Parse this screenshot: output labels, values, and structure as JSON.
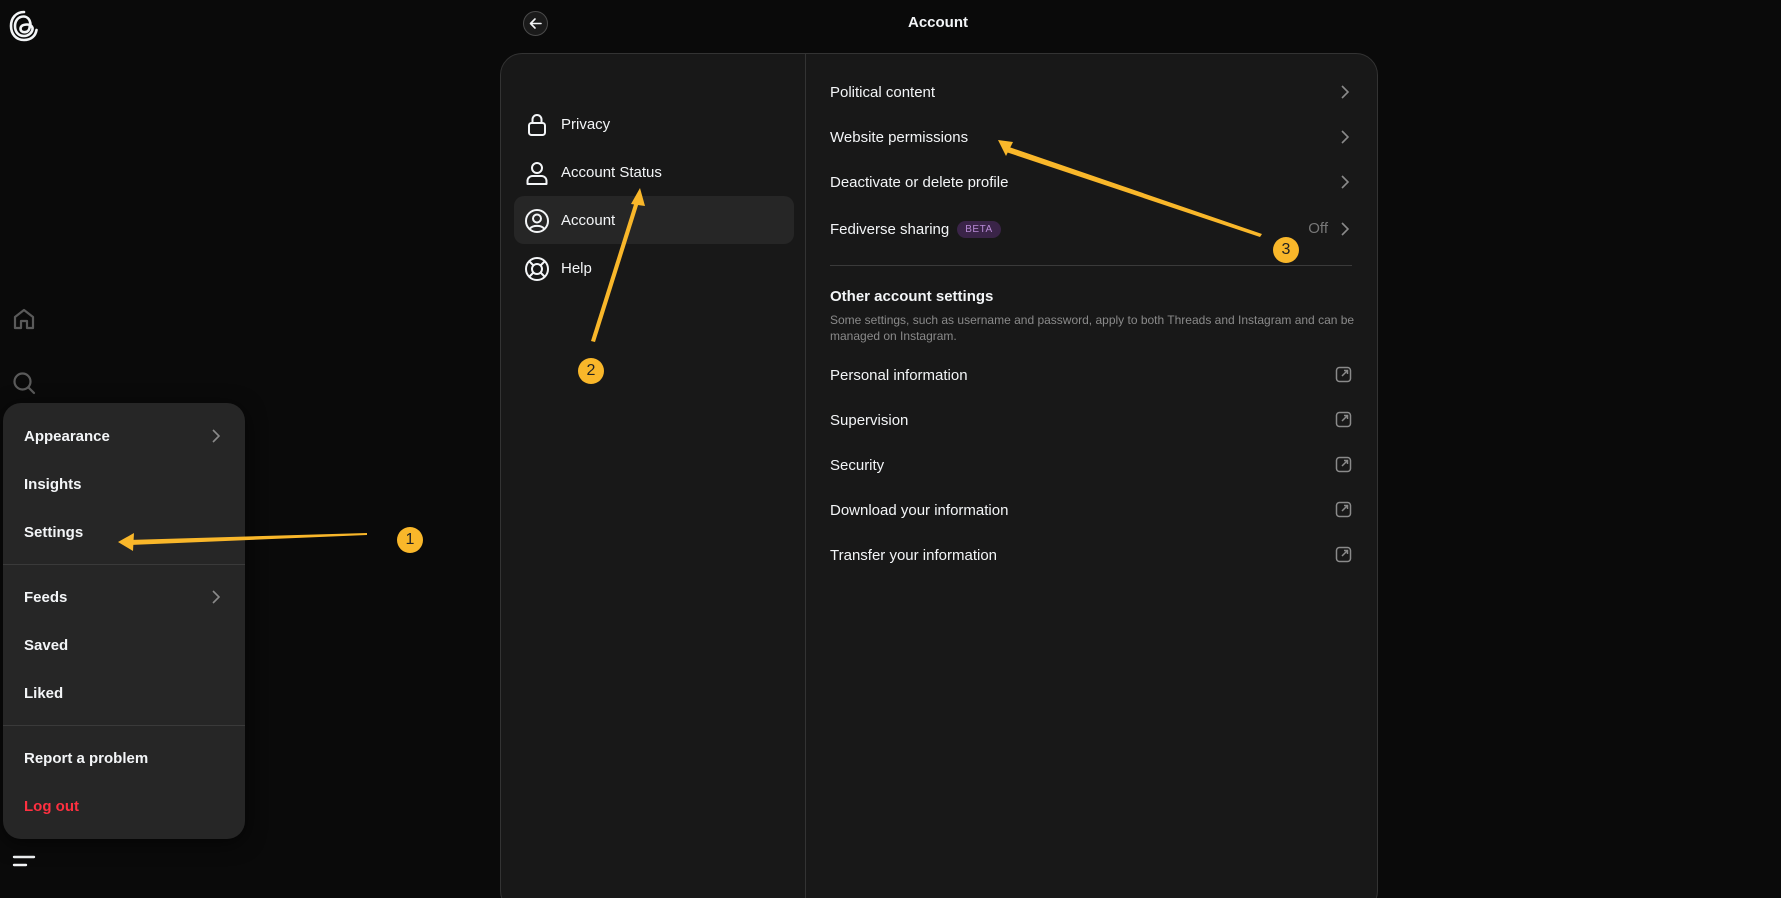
{
  "header": {
    "title": "Account"
  },
  "rail": {
    "icons": [
      "threads-logo",
      "home-icon",
      "search-icon",
      "menu-icon"
    ]
  },
  "menu": {
    "items": [
      {
        "label": "Appearance",
        "has_chevron": true
      },
      {
        "label": "Insights"
      },
      {
        "label": "Settings"
      },
      {
        "label": "Feeds",
        "has_chevron": true
      },
      {
        "label": "Saved"
      },
      {
        "label": "Liked"
      },
      {
        "label": "Report a problem"
      },
      {
        "label": "Log out",
        "danger": true
      }
    ]
  },
  "nav": {
    "items": [
      {
        "label": "Privacy",
        "icon": "lock-icon"
      },
      {
        "label": "Account Status",
        "icon": "person-icon"
      },
      {
        "label": "Account",
        "icon": "account-circle-icon",
        "active": true
      },
      {
        "label": "Help",
        "icon": "lifebuoy-icon"
      }
    ]
  },
  "content": {
    "rows": [
      {
        "label": "Political content"
      },
      {
        "label": "Website permissions"
      },
      {
        "label": "Deactivate or delete profile"
      },
      {
        "label": "Fediverse sharing",
        "badge": "BETA",
        "trailing": "Off"
      }
    ],
    "other_section": {
      "title": "Other account settings",
      "description": "Some settings, such as username and password, apply to both Threads and Instagram and can be managed on Instagram."
    },
    "external_rows": [
      {
        "label": "Personal information"
      },
      {
        "label": "Supervision"
      },
      {
        "label": "Security"
      },
      {
        "label": "Download your information"
      },
      {
        "label": "Transfer your information"
      }
    ]
  },
  "annotations": {
    "badges": [
      "1",
      "2",
      "3"
    ],
    "color": "#f9b72a"
  },
  "colors": {
    "background": "#0a0a0a",
    "card": "#181818",
    "menu": "#262626",
    "danger": "#ff3040",
    "beta_bg": "#3a2448",
    "beta_text": "#b88ad6"
  }
}
